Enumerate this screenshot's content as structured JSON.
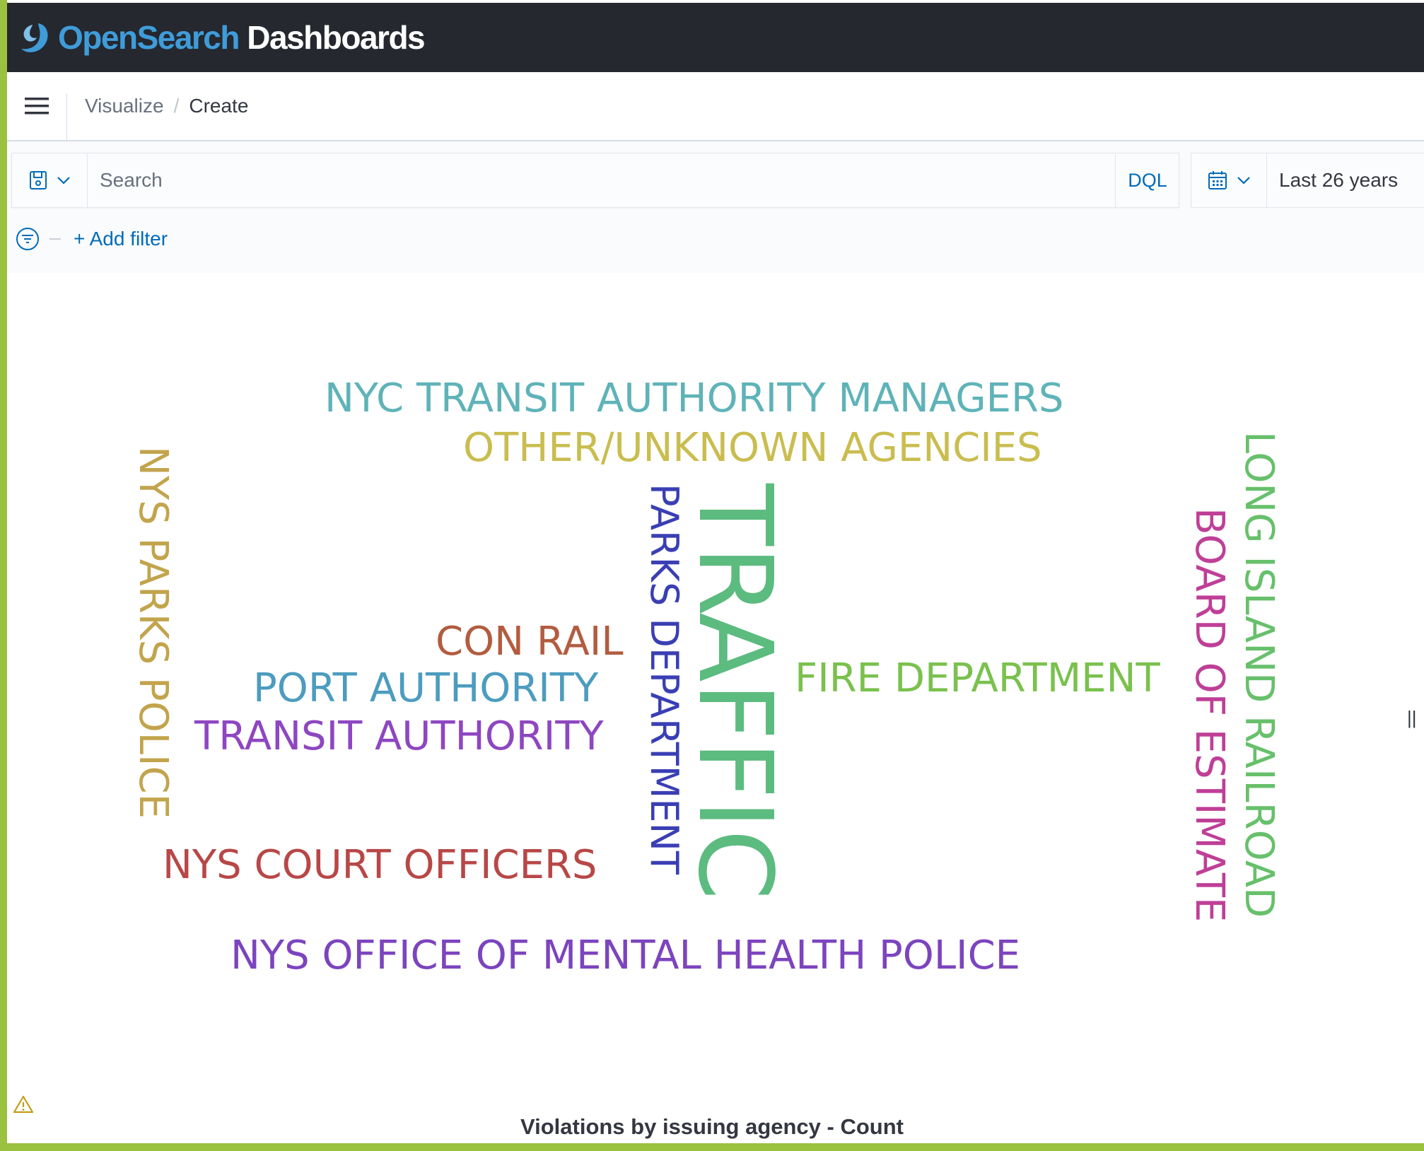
{
  "app": {
    "logo_part1": "Open",
    "logo_part2": "Search",
    "logo_part3": " Dashboards",
    "logo_icon": "opensearch-logo-icon"
  },
  "header": {
    "menu_icon": "hamburger-menu-icon",
    "breadcrumbs": [
      "Visualize",
      "Create"
    ],
    "separator": "/"
  },
  "querybar": {
    "saved_query_icon": "save-disk-icon",
    "search_placeholder": "Search",
    "language_label": "DQL",
    "date_icon": "calendar-icon",
    "date_range": "Last 26 years",
    "filter_icon": "filter-icon",
    "add_filter_label": "+ Add filter"
  },
  "visualization": {
    "title": "Violations by issuing agency - Count",
    "warning_icon": "warning-triangle-icon",
    "resize_handle": "||"
  },
  "chart_data": {
    "type": "tag_cloud",
    "title": "Violations by issuing agency - Count",
    "words": [
      {
        "text": "TRAFFIC",
        "color": "#54b399",
        "orientation": "vertical"
      },
      {
        "text": "NYC TRANSIT AUTHORITY MANAGERS",
        "color": "#6092c0",
        "orientation": "horizontal"
      },
      {
        "text": "OTHER/UNKNOWN AGENCIES",
        "color": "#d6bf57",
        "orientation": "horizontal"
      },
      {
        "text": "NYS PARKS POLICE",
        "color": "#b9a888",
        "orientation": "vertical"
      },
      {
        "text": "PARKS DEPARTMENT",
        "color": "#3c3ab8",
        "orientation": "vertical"
      },
      {
        "text": "CON RAIL",
        "color": "#b45a45",
        "orientation": "horizontal"
      },
      {
        "text": "PORT AUTHORITY",
        "color": "#5a9dc2",
        "orientation": "horizontal"
      },
      {
        "text": "TRANSIT AUTHORITY",
        "color": "#9052c4",
        "orientation": "horizontal"
      },
      {
        "text": "FIRE DEPARTMENT",
        "color": "#7bc44c",
        "orientation": "horizontal"
      },
      {
        "text": "BOARD OF ESTIMATE",
        "color": "#c0469e",
        "orientation": "vertical"
      },
      {
        "text": "LONG ISLAND RAILROAD",
        "color": "#6ac46a",
        "orientation": "vertical"
      },
      {
        "text": "NYS COURT OFFICERS",
        "color": "#bf4f4f",
        "orientation": "horizontal"
      },
      {
        "text": "NYS OFFICE OF MENTAL HEALTH POLICE",
        "color": "#7e45c2",
        "orientation": "horizontal"
      }
    ]
  }
}
